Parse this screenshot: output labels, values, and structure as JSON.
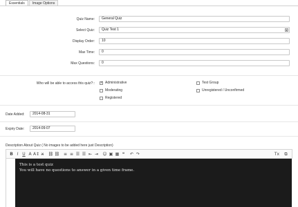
{
  "tabs": [
    {
      "label": "Essentials",
      "active": true
    },
    {
      "label": "Image Options",
      "active": false
    }
  ],
  "form": {
    "quiz_name": {
      "label": "Quiz Name:",
      "value": "General Quiz"
    },
    "select_quiz": {
      "label": "Select Quiz:",
      "value": "Quiz Test 1"
    },
    "display_order": {
      "label": "Display Order:",
      "value": "10"
    },
    "max_time": {
      "label": "Max Time:",
      "value": "0"
    },
    "max_questions": {
      "label": "Max Questions:",
      "value": "0"
    }
  },
  "access": {
    "label": "Who will be able to access this quiz?::",
    "options": [
      {
        "label": "Administrative",
        "checked": true
      },
      {
        "label": "Moderating",
        "checked": false
      },
      {
        "label": "Registered",
        "checked": false
      },
      {
        "label": "Test Group",
        "checked": false
      },
      {
        "label": "Unregistered / Unconfirmed",
        "checked": false
      }
    ]
  },
  "date_added": {
    "label": "Date Added:",
    "value": "2014-08-31"
  },
  "expiry_date": {
    "label": "Expiry Date:",
    "value": "2014-09-07"
  },
  "description": {
    "label": "Description About Quiz ( No images to be added here just Description)",
    "lines": [
      "This is a test quiz",
      "You will have no questions to answer in a given time frame."
    ]
  },
  "toolbar": {
    "buttons": [
      {
        "name": "bold-icon",
        "glyph": "B"
      },
      {
        "name": "italic-icon",
        "glyph": "I"
      },
      {
        "name": "underline-icon",
        "glyph": "U"
      },
      {
        "name": "font-color-icon",
        "glyph": "A"
      },
      {
        "name": "font-size-icon",
        "glyph": "A↕"
      },
      {
        "name": "strikethrough-icon",
        "glyph": "x̶"
      },
      {
        "name": "link-icon",
        "glyph": "⛓"
      },
      {
        "name": "unlink-icon",
        "glyph": "⛓"
      },
      {
        "name": "align-left-icon",
        "glyph": "≡"
      },
      {
        "name": "align-center-icon",
        "glyph": "≡"
      },
      {
        "name": "bulleted-list-icon",
        "glyph": "☰"
      },
      {
        "name": "numbered-list-icon",
        "glyph": "☰"
      },
      {
        "name": "outdent-icon",
        "glyph": "⇤"
      },
      {
        "name": "indent-icon",
        "glyph": "⇥"
      },
      {
        "name": "smiley-icon",
        "glyph": "☺"
      },
      {
        "name": "image-icon",
        "glyph": "▣"
      },
      {
        "name": "media-icon",
        "glyph": "▦"
      },
      {
        "name": "quote-icon",
        "glyph": "❝"
      },
      {
        "name": "undo-icon",
        "glyph": "↶"
      },
      {
        "name": "redo-icon",
        "glyph": "↷"
      }
    ],
    "remove_format_glyph": "Tx",
    "source_glyph": "⧉"
  }
}
